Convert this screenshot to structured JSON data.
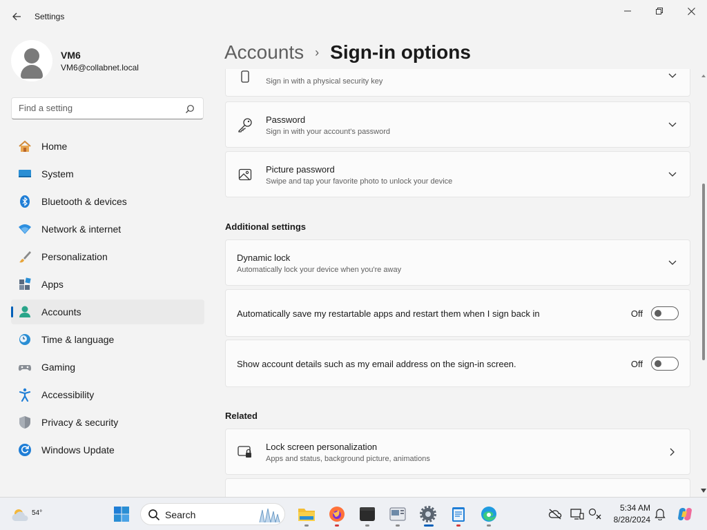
{
  "window": {
    "title": "Settings"
  },
  "profile": {
    "name": "VM6",
    "email": "VM6@collabnet.local"
  },
  "search": {
    "placeholder": "Find a setting"
  },
  "nav": [
    {
      "label": "Home",
      "icon": "home-icon"
    },
    {
      "label": "System",
      "icon": "system-icon"
    },
    {
      "label": "Bluetooth & devices",
      "icon": "bluetooth-icon"
    },
    {
      "label": "Network & internet",
      "icon": "wifi-icon"
    },
    {
      "label": "Personalization",
      "icon": "brush-icon"
    },
    {
      "label": "Apps",
      "icon": "apps-icon"
    },
    {
      "label": "Accounts",
      "icon": "accounts-icon",
      "active": true
    },
    {
      "label": "Time & language",
      "icon": "clock-globe-icon"
    },
    {
      "label": "Gaming",
      "icon": "gamepad-icon"
    },
    {
      "label": "Accessibility",
      "icon": "accessibility-icon"
    },
    {
      "label": "Privacy & security",
      "icon": "shield-icon"
    },
    {
      "label": "Windows Update",
      "icon": "update-icon"
    }
  ],
  "breadcrumb": {
    "parent": "Accounts",
    "separator": "›",
    "current": "Sign-in options"
  },
  "main": {
    "security_key": {
      "subtitle": "Sign in with a physical security key"
    },
    "password": {
      "title": "Password",
      "subtitle": "Sign in with your account's password"
    },
    "picture_password": {
      "title": "Picture password",
      "subtitle": "Swipe and tap your favorite photo to unlock your device"
    },
    "additional_settings": {
      "heading": "Additional settings",
      "dynamic_lock": {
        "title": "Dynamic lock",
        "subtitle": "Automatically lock your device when you're away"
      },
      "restart_apps": {
        "label": "Automatically save my restartable apps and restart them when I sign back in",
        "state": "Off"
      },
      "account_details": {
        "label": "Show account details such as my email address on the sign-in screen.",
        "state": "Off"
      }
    },
    "related": {
      "heading": "Related",
      "lock_screen": {
        "title": "Lock screen personalization",
        "subtitle": "Apps and status, background picture, animations"
      }
    }
  },
  "taskbar": {
    "weather_temp": "54°",
    "search_label": "Search",
    "time": "5:34 AM",
    "date": "8/28/2024",
    "pinned": [
      "start-icon",
      "search-icon",
      "file-explorer-icon",
      "firefox-icon",
      "terminal-icon",
      "media-app-icon",
      "settings-icon",
      "notepad-icon",
      "edge-icon"
    ]
  },
  "colors": {
    "accent": "#005fb8",
    "background": "#f3f3f3",
    "card": "#fbfbfb"
  }
}
